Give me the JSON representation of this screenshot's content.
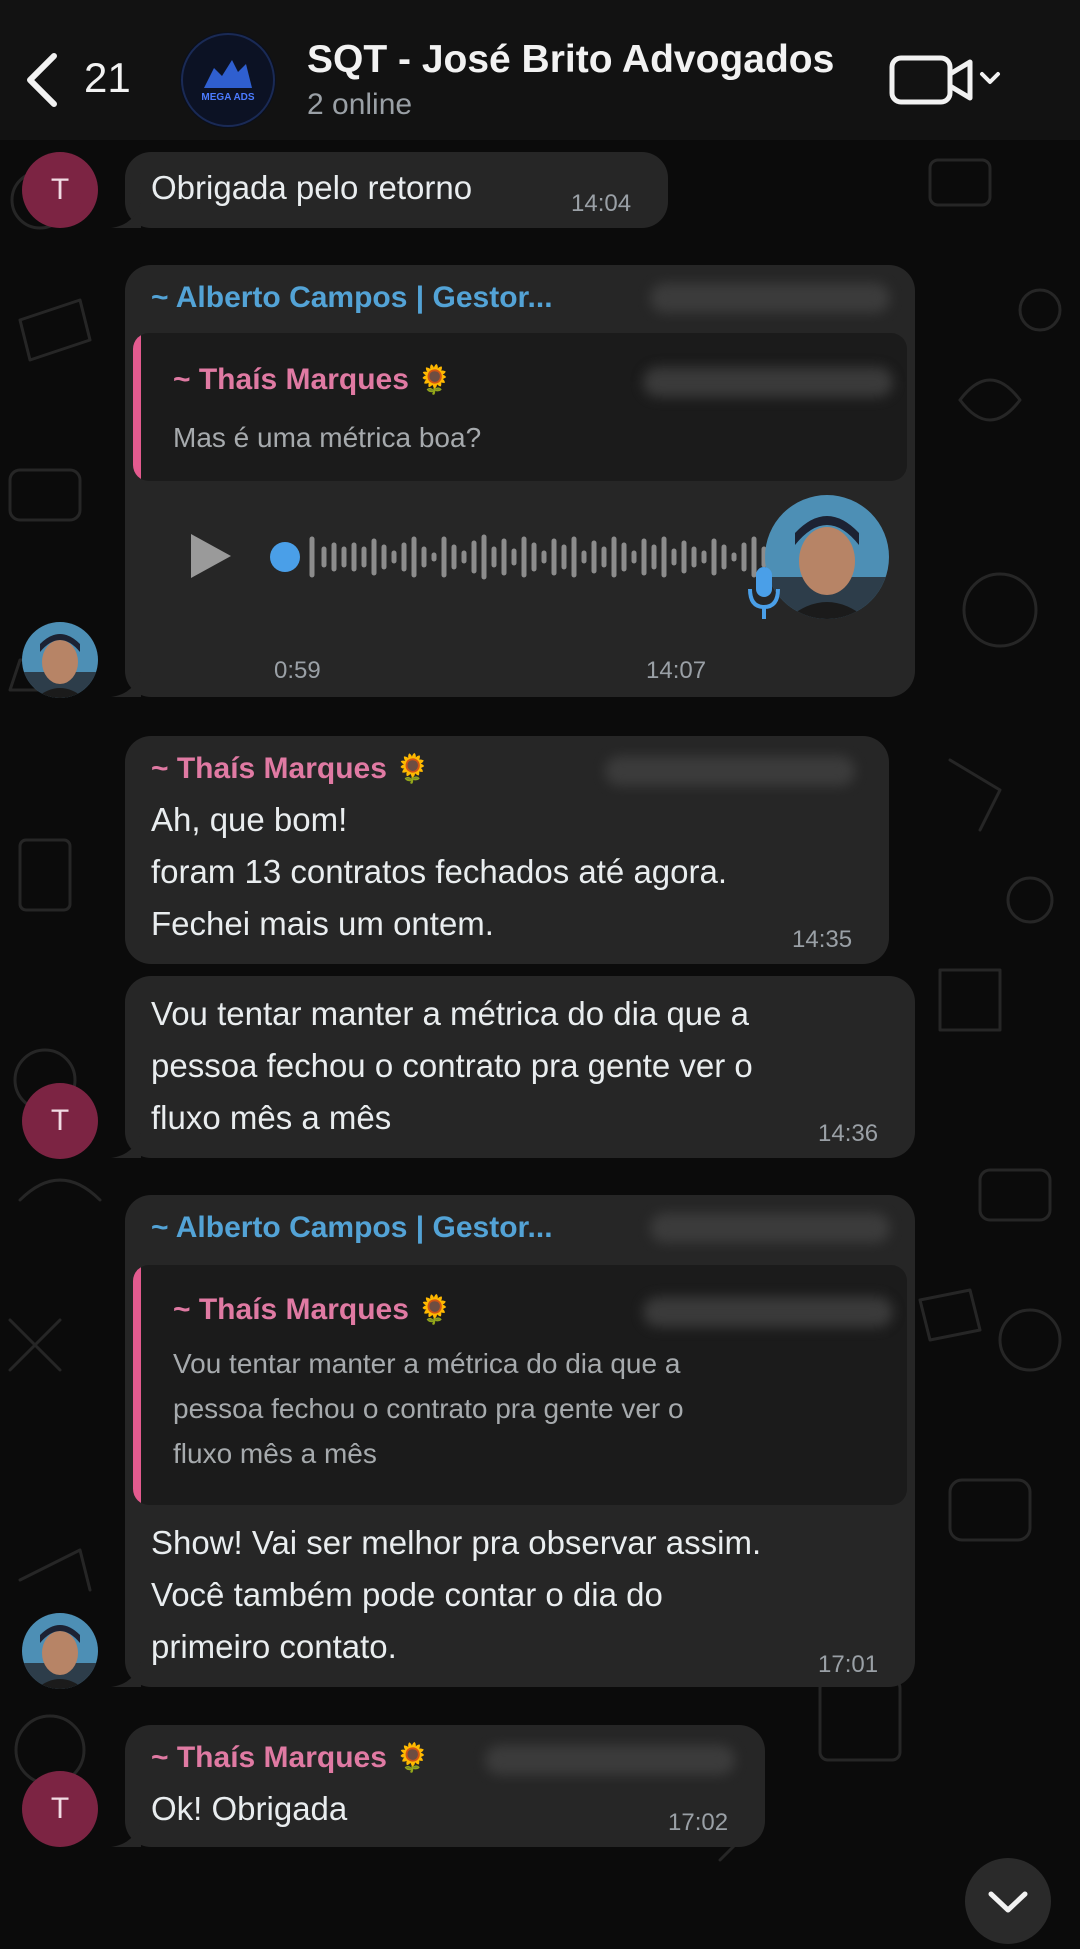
{
  "header": {
    "back_count": "21",
    "title": "SQT - José Brito Advogados",
    "subtitle": "2 online",
    "avatar_text": "MEGA ADS"
  },
  "messages": [
    {
      "text": "Obrigada pelo retorno",
      "time": "14:04",
      "author_initial": "T"
    },
    {
      "sender": "~ Alberto Campos | Gestor...",
      "quote_sender": "~ Thaís Marques",
      "quote_text": "Mas é uma métrica boa?",
      "voice_duration": "0:59",
      "time": "14:07"
    },
    {
      "sender": "~ Thaís Marques",
      "text": "Ah, que bom!\nforam 13 contratos fechados até agora.\nFechei mais um ontem.",
      "time": "14:35"
    },
    {
      "text": "Vou tentar manter a métrica do dia que a\npessoa fechou o contrato pra gente ver o\nfluxo mês a mês",
      "time": "14:36",
      "author_initial": "T"
    },
    {
      "sender": "~ Alberto Campos | Gestor...",
      "quote_sender": "~ Thaís Marques",
      "quote_text": "Vou tentar manter a métrica do dia que a\npessoa fechou o contrato pra gente ver o\nfluxo mês a mês",
      "text": "Show! Vai ser melhor pra observar assim.\nVocê também pode contar o dia do\nprimeiro contato.",
      "time": "17:01"
    },
    {
      "sender": "~ Thaís Marques",
      "text": "Ok! Obrigada",
      "time": "17:02",
      "author_initial": "T"
    }
  ],
  "emoji": "🌻",
  "colors": {
    "sender_blue": "#53a3d6",
    "sender_pink": "#e07aa3",
    "bubble": "#262626",
    "avatar_t": "#7c2443",
    "voice_accent": "#4a9fe8"
  }
}
